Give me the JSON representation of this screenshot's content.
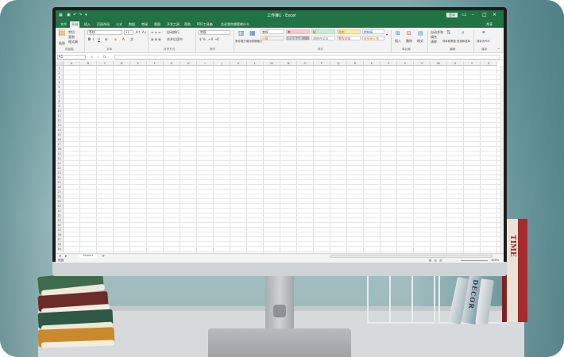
{
  "window": {
    "title": "工作簿1 - Excel",
    "login": "登录",
    "share": "共享"
  },
  "tabs": [
    "文件",
    "开始",
    "插入",
    "页面布局",
    "公式",
    "数据",
    "审阅",
    "视图",
    "开发工具",
    "帮助",
    "PDF工具箱",
    "告诉我你想要做什么"
  ],
  "ribbon": {
    "clipboard": {
      "paste": "粘贴",
      "cut": "剪切",
      "copy": "复制",
      "format_painter": "格式刷",
      "label": "剪贴板"
    },
    "font": {
      "name": "等线",
      "size": "11",
      "bold": "B",
      "italic": "I",
      "underline": "U",
      "label": "字体"
    },
    "alignment": {
      "wrap": "自动换行",
      "merge": "合并后居中",
      "label": "对齐方式"
    },
    "number": {
      "format": "常规",
      "label": "数字"
    },
    "styles": {
      "conditional": "条件格式",
      "table": "套用表格格式",
      "cells": [
        "常规",
        "差",
        "好",
        "适中",
        "超链接",
        "计算",
        "检查单元格",
        "解释性文本",
        "警告文本",
        "链接单元格"
      ],
      "label": "样式"
    },
    "cells": {
      "insert": "插入",
      "delete": "删除",
      "format": "格式",
      "label": "单元格"
    },
    "editing": {
      "autosum": "自动求和",
      "fill": "填充",
      "clear": "清除",
      "sort": "排序和筛选",
      "find": "查找和选择",
      "label": "编辑"
    },
    "pdf": {
      "save": "保存为PDF",
      "label": "保存"
    }
  },
  "formula_bar": {
    "cell": "A1",
    "fx": "fx",
    "value": ""
  },
  "columns": [
    "A",
    "B",
    "C",
    "D",
    "E",
    "F",
    "G",
    "H",
    "I",
    "J",
    "K",
    "L",
    "M",
    "N",
    "O",
    "P",
    "Q",
    "R",
    "S",
    "T",
    "U",
    "V",
    "W",
    "X",
    "Y",
    "Z"
  ],
  "rows": [
    "1",
    "2",
    "3",
    "4",
    "5",
    "6",
    "7",
    "8",
    "9",
    "10",
    "11",
    "12",
    "13",
    "14",
    "15",
    "16",
    "17",
    "18",
    "19",
    "20",
    "21",
    "22",
    "23",
    "24",
    "25",
    "26",
    "27",
    "28",
    "29",
    "30",
    "31",
    "32",
    "33",
    "34",
    "35",
    "36",
    "37",
    "38",
    "39"
  ],
  "sheets": [
    "Sheet1"
  ],
  "add_sheet": "+",
  "status": {
    "ready": "就绪",
    "zoom": "100%"
  },
  "decor": {
    "mag_text": "DECOR",
    "tall_text": "TIME"
  },
  "colors": {
    "excel_green": "#217346"
  }
}
